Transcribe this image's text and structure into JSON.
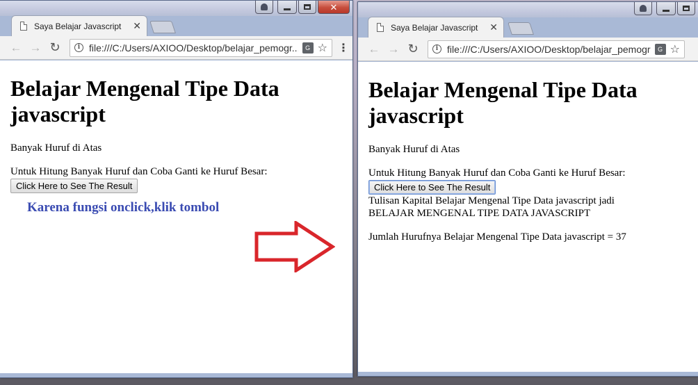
{
  "left_window": {
    "tab": {
      "title": "Saya Belajar Javascript",
      "close": "✕"
    },
    "address": {
      "url": "file:///C:/Users/AXIOO/Desktop/belajar_pemogr..."
    },
    "page": {
      "heading": "Belajar Mengenal Tipe Data javascript",
      "subtext": "Banyak Huruf di Atas",
      "instruction": "Untuk Hitung Banyak Huruf dan Coba Ganti ke Huruf Besar:",
      "button_label": "Click Here to See The Result"
    },
    "annotation": "Karena fungsi onclick,klik tombol"
  },
  "right_window": {
    "tab": {
      "title": "Saya Belajar Javascript",
      "close": "✕"
    },
    "address": {
      "url": "file:///C:/Users/AXIOO/Desktop/belajar_pemogr..."
    },
    "page": {
      "heading": "Belajar Mengenal Tipe Data javascript",
      "subtext": "Banyak Huruf di Atas",
      "instruction": "Untuk Hitung Banyak Huruf dan Coba Ganti ke Huruf Besar:",
      "button_label": "Click Here to See The Result",
      "result_line1": "Tulisan Kapital Belajar Mengenal Tipe Data javascript jadi",
      "result_line2": "BELAJAR MENGENAL TIPE DATA JAVASCRIPT",
      "result_count": "Jumlah Hurufnya Belajar Mengenal Tipe Data javascript = 37"
    }
  },
  "colors": {
    "annotation": "#3a4bb2",
    "arrow_stroke": "#d9262b",
    "close_button": "#c74d3c"
  },
  "icons": [
    "page-icon",
    "back-arrow-icon",
    "forward-arrow-icon",
    "reload-icon",
    "info-icon",
    "translate-icon",
    "star-icon",
    "menu-icon",
    "right-arrow-icon"
  ]
}
